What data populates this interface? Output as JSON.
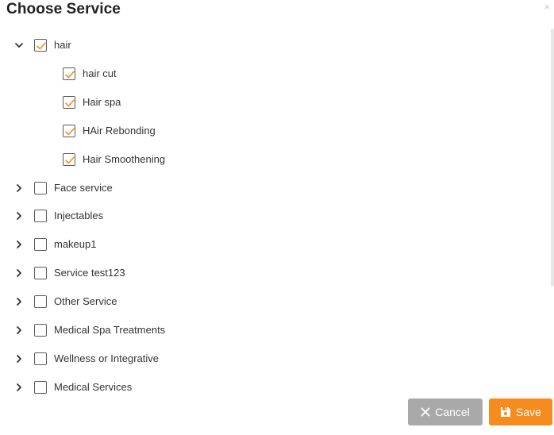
{
  "dialog": {
    "title": "Choose Service",
    "close_glyph": "×"
  },
  "colors": {
    "accent": "#f68b1f",
    "cancel_bg": "#a9a9a9"
  },
  "tree": [
    {
      "label": "hair",
      "expanded": true,
      "checked": true,
      "children": [
        {
          "label": "hair cut",
          "checked": true
        },
        {
          "label": "Hair spa",
          "checked": true
        },
        {
          "label": "HAir Rebonding",
          "checked": true
        },
        {
          "label": "Hair Smoothening",
          "checked": true
        }
      ]
    },
    {
      "label": "Face service",
      "expanded": false,
      "checked": false
    },
    {
      "label": "Injectables",
      "expanded": false,
      "checked": false
    },
    {
      "label": "makeup1",
      "expanded": false,
      "checked": false
    },
    {
      "label": "Service test123",
      "expanded": false,
      "checked": false
    },
    {
      "label": "Other Service",
      "expanded": false,
      "checked": false
    },
    {
      "label": "Medical Spa Treatments",
      "expanded": false,
      "checked": false
    },
    {
      "label": "Wellness or Integrative",
      "expanded": false,
      "checked": false
    },
    {
      "label": "Medical Services",
      "expanded": false,
      "checked": false
    }
  ],
  "footer": {
    "cancel_label": "Cancel",
    "cancel_icon": "close-icon",
    "save_label": "Save",
    "save_icon": "floppy-disk-icon"
  }
}
